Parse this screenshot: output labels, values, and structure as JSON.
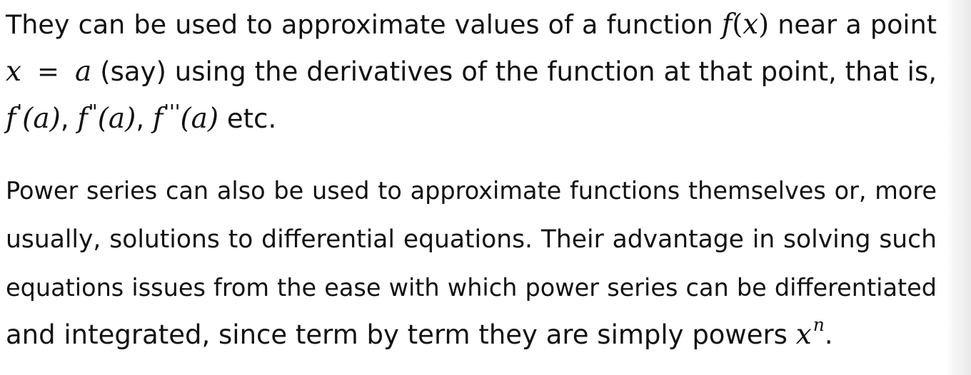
{
  "paragraph1": {
    "line1_text": "They can be used to approximate values of a function",
    "line1_fx_f": "f",
    "line1_fx_open": "(",
    "line1_fx_x": "x",
    "line1_fx_close": ")",
    "line1_tail": "near a point",
    "line2_x": "x",
    "line2_eq": "=",
    "line2_a": "a",
    "line2_text": "(say) using the derivatives of the function at that point, that is,",
    "line3_f1": "f",
    "line3_p1": "'",
    "line3_arg1": "(a)",
    "line3_f2": "f",
    "line3_p2": "\"",
    "line3_arg2": "(a)",
    "line3_f3": "f",
    "line3_p3": "'''",
    "line3_arg3": "(a)",
    "line3_tail": "etc."
  },
  "paragraph2": {
    "line1": "Power series can also be used to approximate functions themselves or, more",
    "line2": "usually, solutions to differential equations.  Their advantage in solving such",
    "line3": "equations issues from the ease with which power series can be differentiated",
    "line4_text": "and integrated, since term by term they are simply powers",
    "line4_base": "x",
    "line4_exp": "n",
    "line4_end": "."
  }
}
